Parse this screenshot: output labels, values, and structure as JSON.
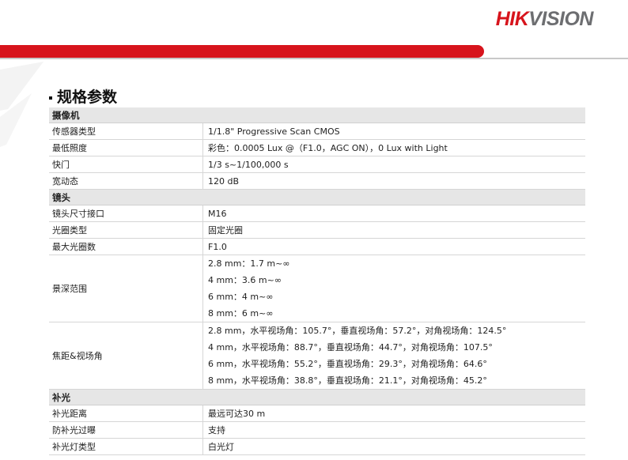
{
  "brand": {
    "part1": "HIK",
    "part2": "VISION"
  },
  "section_title": "规格参数",
  "camera": {
    "header": "摄像机",
    "rows": [
      {
        "label": "传感器类型",
        "value": "1/1.8\" Progressive Scan CMOS"
      },
      {
        "label": "最低照度",
        "value": "彩色：0.0005 Lux @（F1.0，AGC ON），0 Lux with Light"
      },
      {
        "label": "快门",
        "value": "1/3 s~1/100,000 s"
      },
      {
        "label": "宽动态",
        "value": "120 dB"
      }
    ]
  },
  "lens": {
    "header": "镜头",
    "rows": [
      {
        "label": "镜头尺寸接口",
        "value": "M16"
      },
      {
        "label": "光圈类型",
        "value": "固定光圈"
      },
      {
        "label": "最大光圈数",
        "value": "F1.0"
      }
    ],
    "dof": {
      "label": "景深范围",
      "values": [
        "2.8 mm：1.7 m~∞",
        "4 mm：3.6 m~∞",
        "6 mm：4 m~∞",
        "8 mm：6 m~∞"
      ]
    },
    "fov": {
      "label": "焦距&视场角",
      "values": [
        "2.8 mm，水平视场角：105.7°，垂直视场角：57.2°，对角视场角：124.5°",
        "4 mm，水平视场角：88.7°，垂直视场角：44.7°，对角视场角：107.5°",
        "6 mm，水平视场角：55.2°，垂直视场角：29.3°，对角视场角：64.6°",
        "8 mm，水平视场角：38.8°，垂直视场角：21.1°，对角视场角：45.2°"
      ]
    }
  },
  "fill_light": {
    "header": "补光",
    "rows": [
      {
        "label": "补光距离",
        "value": "最远可达30 m"
      },
      {
        "label": "防补光过曝",
        "value": "支持"
      },
      {
        "label": "补光灯类型",
        "value": "白光灯"
      }
    ]
  }
}
